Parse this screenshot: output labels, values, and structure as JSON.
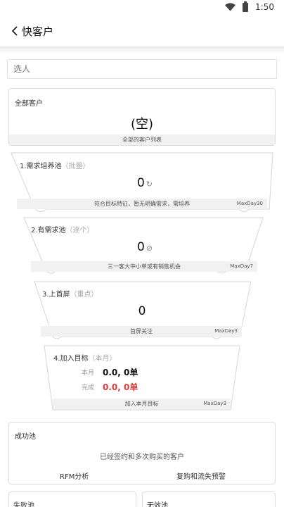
{
  "status": {
    "time": "1:50"
  },
  "header": {
    "title": "快客户"
  },
  "search": {
    "placeholder": "选人"
  },
  "all_customers": {
    "title": "全部客户",
    "value": "(空)",
    "footer": "全部的客户列表"
  },
  "funnel": [
    {
      "title": "1.需求培养池",
      "sub": "（批量）",
      "value": "0",
      "icon": "refresh-icon",
      "icon_glyph": "↻",
      "footer": "符合目标特征，暂无明确需求，需培养",
      "maxday": "MaxDay30"
    },
    {
      "title": "2.有需求池",
      "sub": "（逐个）",
      "value": "0",
      "icon": "leaf-icon",
      "icon_glyph": "⊘",
      "footer": "三一客大中小单或有销售机会",
      "maxday": "MaxDay7"
    },
    {
      "title": "3.上首屏",
      "sub": "（重点）",
      "value": "0",
      "footer": "首屏关注",
      "maxday": "MaxDay3"
    },
    {
      "title": "4.加入目标",
      "sub": "（本月）",
      "footer": "加入本月目标",
      "maxday": "MaxDay3",
      "rows": [
        {
          "label": "本月",
          "value": "0.0, 0单",
          "color": "#111111"
        },
        {
          "label": "完成",
          "value": "0.0, 0单",
          "color": "#e23b3b"
        }
      ]
    }
  ],
  "success_pool": {
    "title": "成功池",
    "desc": "已经签约和多次购买的客户",
    "link_rfm": "RFM分析",
    "link_repurchase": "复购和流失预警"
  },
  "fail_pool": {
    "title": "失败池"
  },
  "invalid_pool": {
    "title": "无效池"
  }
}
